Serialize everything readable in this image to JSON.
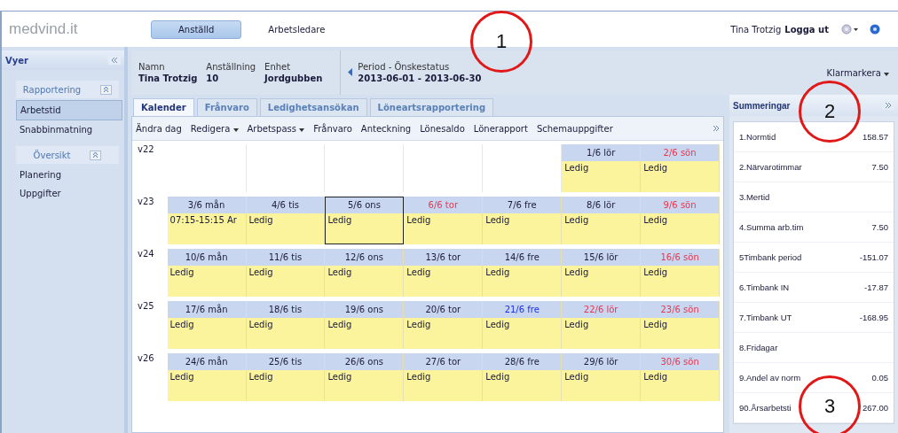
{
  "topbar": {
    "logo": "medvind.it",
    "roles": [
      {
        "label": "Anställd",
        "selected": true
      },
      {
        "label": "Arbetsledare",
        "selected": false
      }
    ],
    "user": "Tina Trotzig",
    "logout": "Logga ut"
  },
  "sidebar": {
    "title": "Vyer",
    "groups": [
      {
        "title": "Rapportering",
        "items": [
          {
            "label": "Arbetstid",
            "selected": true
          },
          {
            "label": "Snabbinmatning",
            "selected": false
          }
        ]
      },
      {
        "title": "Översikt",
        "items": [
          {
            "label": "Planering",
            "selected": false
          },
          {
            "label": "Uppgifter",
            "selected": false
          }
        ]
      }
    ]
  },
  "info": {
    "fields": [
      {
        "label": "Namn",
        "value": "Tina Trotzig"
      },
      {
        "label": "Anställning",
        "value": "10"
      },
      {
        "label": "Enhet",
        "value": "Jordgubben"
      }
    ],
    "period_label": "Period - Önskestatus",
    "period_value": "2013-06-01 - 2013-06-30",
    "action": "Klarmarkera"
  },
  "tabs": [
    {
      "label": "Kalender",
      "selected": true
    },
    {
      "label": "Frånvaro",
      "selected": false
    },
    {
      "label": "Ledighetsansökan",
      "selected": false
    },
    {
      "label": "Löneartsrapportering",
      "selected": false
    }
  ],
  "toolbar": [
    {
      "label": "Ändra dag",
      "dropdown": false
    },
    {
      "label": "Redigera",
      "dropdown": true
    },
    {
      "label": "Arbetspass",
      "dropdown": true
    },
    {
      "label": "Frånvaro",
      "dropdown": false
    },
    {
      "label": "Anteckning",
      "dropdown": false
    },
    {
      "label": "Lönesaldo",
      "dropdown": false
    },
    {
      "label": "Lönerapport",
      "dropdown": false
    },
    {
      "label": "Schemauppgifter",
      "dropdown": false
    }
  ],
  "weeks": [
    {
      "week": "v22",
      "days": [
        {
          "kind": "blank",
          "selected": false
        },
        {
          "kind": "blank",
          "selected": false
        },
        {
          "kind": "blank",
          "selected": false
        },
        {
          "kind": "blank",
          "selected": false
        },
        {
          "kind": "blank",
          "selected": false
        },
        {
          "kind": "day",
          "date": "1/6 lör",
          "color": "#1a1a3a",
          "entry": "Ledig",
          "selected": false
        },
        {
          "kind": "day",
          "date": "2/6 sön",
          "color": "#e8364f",
          "entry": "Ledig",
          "selected": false
        }
      ]
    },
    {
      "week": "v23",
      "days": [
        {
          "kind": "day",
          "date": "3/6 mån",
          "color": "#1a1a3a",
          "entry": "07:15-15:15 Ar",
          "selected": false
        },
        {
          "kind": "day",
          "date": "4/6 tis",
          "color": "#1a1a3a",
          "entry": "Ledig",
          "selected": false
        },
        {
          "kind": "day",
          "date": "5/6 ons",
          "color": "#1a1a3a",
          "entry": "Ledig",
          "selected": true
        },
        {
          "kind": "day",
          "date": "6/6 tor",
          "color": "#e8364f",
          "entry": "Ledig",
          "selected": false
        },
        {
          "kind": "day",
          "date": "7/6 fre",
          "color": "#1a1a3a",
          "entry": "Ledig",
          "selected": false
        },
        {
          "kind": "day",
          "date": "8/6 lör",
          "color": "#1a1a3a",
          "entry": "Ledig",
          "selected": false
        },
        {
          "kind": "day",
          "date": "9/6 sön",
          "color": "#e8364f",
          "entry": "Ledig",
          "selected": false
        }
      ]
    },
    {
      "week": "v24",
      "days": [
        {
          "kind": "day",
          "date": "10/6 mån",
          "color": "#1a1a3a",
          "entry": "Ledig",
          "selected": false
        },
        {
          "kind": "day",
          "date": "11/6 tis",
          "color": "#1a1a3a",
          "entry": "Ledig",
          "selected": false
        },
        {
          "kind": "day",
          "date": "12/6 ons",
          "color": "#1a1a3a",
          "entry": "Ledig",
          "selected": false
        },
        {
          "kind": "day",
          "date": "13/6 tor",
          "color": "#1a1a3a",
          "entry": "Ledig",
          "selected": false
        },
        {
          "kind": "day",
          "date": "14/6 fre",
          "color": "#1a1a3a",
          "entry": "Ledig",
          "selected": false
        },
        {
          "kind": "day",
          "date": "15/6 lör",
          "color": "#1a1a3a",
          "entry": "Ledig",
          "selected": false
        },
        {
          "kind": "day",
          "date": "16/6 sön",
          "color": "#e8364f",
          "entry": "Ledig",
          "selected": false
        }
      ]
    },
    {
      "week": "v25",
      "days": [
        {
          "kind": "day",
          "date": "17/6 mån",
          "color": "#1a1a3a",
          "entry": "Ledig",
          "selected": false
        },
        {
          "kind": "day",
          "date": "18/6 tis",
          "color": "#1a1a3a",
          "entry": "Ledig",
          "selected": false
        },
        {
          "kind": "day",
          "date": "19/6 ons",
          "color": "#1a1a3a",
          "entry": "Ledig",
          "selected": false
        },
        {
          "kind": "day",
          "date": "20/6 tor",
          "color": "#1a1a3a",
          "entry": "Ledig",
          "selected": false
        },
        {
          "kind": "day",
          "date": "21/6 fre",
          "color": "#1a2ee8",
          "entry": "Ledig",
          "selected": false
        },
        {
          "kind": "day",
          "date": "22/6 lör",
          "color": "#e8364f",
          "entry": "Ledig",
          "selected": false
        },
        {
          "kind": "day",
          "date": "23/6 sön",
          "color": "#e8364f",
          "entry": "Ledig",
          "selected": false
        }
      ]
    },
    {
      "week": "v26",
      "days": [
        {
          "kind": "day",
          "date": "24/6 mån",
          "color": "#1a1a3a",
          "entry": "Ledig",
          "selected": false
        },
        {
          "kind": "day",
          "date": "25/6 tis",
          "color": "#1a1a3a",
          "entry": "Ledig",
          "selected": false
        },
        {
          "kind": "day",
          "date": "26/6 ons",
          "color": "#1a1a3a",
          "entry": "Ledig",
          "selected": false
        },
        {
          "kind": "day",
          "date": "27/6 tor",
          "color": "#1a1a3a",
          "entry": "Ledig",
          "selected": false
        },
        {
          "kind": "day",
          "date": "28/6 fre",
          "color": "#1a1a3a",
          "entry": "Ledig",
          "selected": false
        },
        {
          "kind": "day",
          "date": "29/6 lör",
          "color": "#1a1a3a",
          "entry": "Ledig",
          "selected": false
        },
        {
          "kind": "day",
          "date": "30/6 sön",
          "color": "#e8364f",
          "entry": "Ledig",
          "selected": false
        }
      ]
    }
  ],
  "summary": {
    "title": "Summeringar",
    "rows": [
      {
        "label": "1.Normtid",
        "value": "158.57"
      },
      {
        "label": "2.Närvarotimmar",
        "value": "7.50"
      },
      {
        "label": "3.Mertid"
      },
      {
        "label": "4.Summa arb.tim",
        "value": "7.50"
      },
      {
        "label": "5Timbank period",
        "value": "-151.07"
      },
      {
        "label": "6.Timbank IN",
        "value": "-17.87"
      },
      {
        "label": "7.Timbank UT",
        "value": "-168.95"
      },
      {
        "label": "8.Fridagar"
      },
      {
        "label": "9.Andel av norm",
        "value": "0.05"
      },
      {
        "label": "90.Årsarbetsti",
        "value": "267.00"
      }
    ]
  },
  "callouts": [
    "1",
    "2",
    "3"
  ]
}
